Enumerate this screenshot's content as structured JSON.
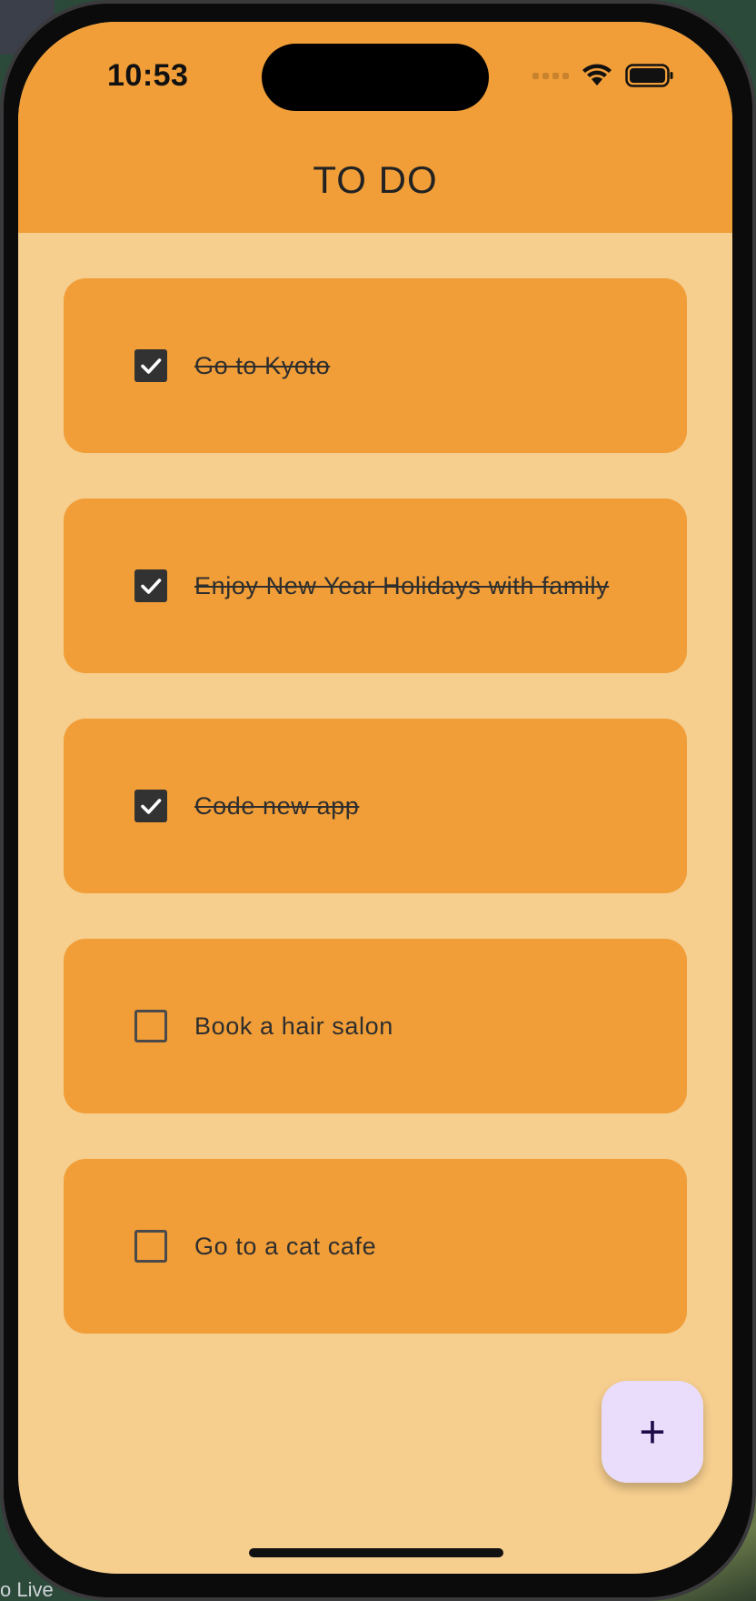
{
  "status_bar": {
    "time": "10:53",
    "icons": [
      "cellular-signal-icon",
      "wifi-icon",
      "battery-icon"
    ]
  },
  "app_bar": {
    "title": "TO DO",
    "color": "#f19e38"
  },
  "todos": [
    {
      "label": "Go to Kyoto",
      "checked": true
    },
    {
      "label": "Enjoy New Year Holidays with family",
      "checked": true
    },
    {
      "label": "Code new app",
      "checked": true
    },
    {
      "label": "Book a hair salon",
      "checked": false
    },
    {
      "label": "Go to a cat cafe",
      "checked": false
    }
  ],
  "fab": {
    "icon": "plus-icon",
    "symbol": "+"
  },
  "background_label": "o Live",
  "colors": {
    "screen_background": "#f6ce8e",
    "card": "#f19e38",
    "fab_background": "#e9ddfb",
    "checkbox_checked": "#323232"
  }
}
